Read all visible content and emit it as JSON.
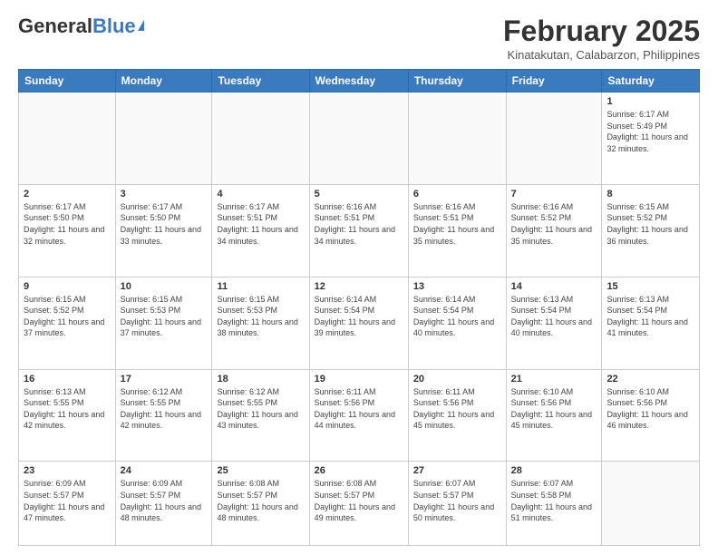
{
  "header": {
    "logo_general": "General",
    "logo_blue": "Blue",
    "month_year": "February 2025",
    "location": "Kinatakutan, Calabarzon, Philippines"
  },
  "weekdays": [
    "Sunday",
    "Monday",
    "Tuesday",
    "Wednesday",
    "Thursday",
    "Friday",
    "Saturday"
  ],
  "weeks": [
    [
      {
        "day": "",
        "info": ""
      },
      {
        "day": "",
        "info": ""
      },
      {
        "day": "",
        "info": ""
      },
      {
        "day": "",
        "info": ""
      },
      {
        "day": "",
        "info": ""
      },
      {
        "day": "",
        "info": ""
      },
      {
        "day": "1",
        "info": "Sunrise: 6:17 AM\nSunset: 5:49 PM\nDaylight: 11 hours\nand 32 minutes."
      }
    ],
    [
      {
        "day": "2",
        "info": "Sunrise: 6:17 AM\nSunset: 5:50 PM\nDaylight: 11 hours\nand 32 minutes."
      },
      {
        "day": "3",
        "info": "Sunrise: 6:17 AM\nSunset: 5:50 PM\nDaylight: 11 hours\nand 33 minutes."
      },
      {
        "day": "4",
        "info": "Sunrise: 6:17 AM\nSunset: 5:51 PM\nDaylight: 11 hours\nand 34 minutes."
      },
      {
        "day": "5",
        "info": "Sunrise: 6:16 AM\nSunset: 5:51 PM\nDaylight: 11 hours\nand 34 minutes."
      },
      {
        "day": "6",
        "info": "Sunrise: 6:16 AM\nSunset: 5:51 PM\nDaylight: 11 hours\nand 35 minutes."
      },
      {
        "day": "7",
        "info": "Sunrise: 6:16 AM\nSunset: 5:52 PM\nDaylight: 11 hours\nand 35 minutes."
      },
      {
        "day": "8",
        "info": "Sunrise: 6:15 AM\nSunset: 5:52 PM\nDaylight: 11 hours\nand 36 minutes."
      }
    ],
    [
      {
        "day": "9",
        "info": "Sunrise: 6:15 AM\nSunset: 5:52 PM\nDaylight: 11 hours\nand 37 minutes."
      },
      {
        "day": "10",
        "info": "Sunrise: 6:15 AM\nSunset: 5:53 PM\nDaylight: 11 hours\nand 37 minutes."
      },
      {
        "day": "11",
        "info": "Sunrise: 6:15 AM\nSunset: 5:53 PM\nDaylight: 11 hours\nand 38 minutes."
      },
      {
        "day": "12",
        "info": "Sunrise: 6:14 AM\nSunset: 5:54 PM\nDaylight: 11 hours\nand 39 minutes."
      },
      {
        "day": "13",
        "info": "Sunrise: 6:14 AM\nSunset: 5:54 PM\nDaylight: 11 hours\nand 40 minutes."
      },
      {
        "day": "14",
        "info": "Sunrise: 6:13 AM\nSunset: 5:54 PM\nDaylight: 11 hours\nand 40 minutes."
      },
      {
        "day": "15",
        "info": "Sunrise: 6:13 AM\nSunset: 5:54 PM\nDaylight: 11 hours\nand 41 minutes."
      }
    ],
    [
      {
        "day": "16",
        "info": "Sunrise: 6:13 AM\nSunset: 5:55 PM\nDaylight: 11 hours\nand 42 minutes."
      },
      {
        "day": "17",
        "info": "Sunrise: 6:12 AM\nSunset: 5:55 PM\nDaylight: 11 hours\nand 42 minutes."
      },
      {
        "day": "18",
        "info": "Sunrise: 6:12 AM\nSunset: 5:55 PM\nDaylight: 11 hours\nand 43 minutes."
      },
      {
        "day": "19",
        "info": "Sunrise: 6:11 AM\nSunset: 5:56 PM\nDaylight: 11 hours\nand 44 minutes."
      },
      {
        "day": "20",
        "info": "Sunrise: 6:11 AM\nSunset: 5:56 PM\nDaylight: 11 hours\nand 45 minutes."
      },
      {
        "day": "21",
        "info": "Sunrise: 6:10 AM\nSunset: 5:56 PM\nDaylight: 11 hours\nand 45 minutes."
      },
      {
        "day": "22",
        "info": "Sunrise: 6:10 AM\nSunset: 5:56 PM\nDaylight: 11 hours\nand 46 minutes."
      }
    ],
    [
      {
        "day": "23",
        "info": "Sunrise: 6:09 AM\nSunset: 5:57 PM\nDaylight: 11 hours\nand 47 minutes."
      },
      {
        "day": "24",
        "info": "Sunrise: 6:09 AM\nSunset: 5:57 PM\nDaylight: 11 hours\nand 48 minutes."
      },
      {
        "day": "25",
        "info": "Sunrise: 6:08 AM\nSunset: 5:57 PM\nDaylight: 11 hours\nand 48 minutes."
      },
      {
        "day": "26",
        "info": "Sunrise: 6:08 AM\nSunset: 5:57 PM\nDaylight: 11 hours\nand 49 minutes."
      },
      {
        "day": "27",
        "info": "Sunrise: 6:07 AM\nSunset: 5:57 PM\nDaylight: 11 hours\nand 50 minutes."
      },
      {
        "day": "28",
        "info": "Sunrise: 6:07 AM\nSunset: 5:58 PM\nDaylight: 11 hours\nand 51 minutes."
      },
      {
        "day": "",
        "info": ""
      }
    ]
  ]
}
